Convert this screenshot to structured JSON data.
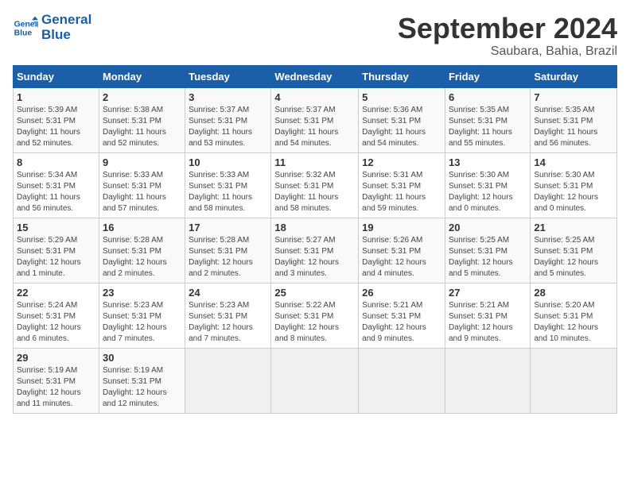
{
  "logo": {
    "line1": "General",
    "line2": "Blue"
  },
  "title": "September 2024",
  "subtitle": "Saubara, Bahia, Brazil",
  "days_of_week": [
    "Sunday",
    "Monday",
    "Tuesday",
    "Wednesday",
    "Thursday",
    "Friday",
    "Saturday"
  ],
  "weeks": [
    [
      {
        "day": "1",
        "info": "Sunrise: 5:39 AM\nSunset: 5:31 PM\nDaylight: 11 hours\nand 52 minutes."
      },
      {
        "day": "2",
        "info": "Sunrise: 5:38 AM\nSunset: 5:31 PM\nDaylight: 11 hours\nand 52 minutes."
      },
      {
        "day": "3",
        "info": "Sunrise: 5:37 AM\nSunset: 5:31 PM\nDaylight: 11 hours\nand 53 minutes."
      },
      {
        "day": "4",
        "info": "Sunrise: 5:37 AM\nSunset: 5:31 PM\nDaylight: 11 hours\nand 54 minutes."
      },
      {
        "day": "5",
        "info": "Sunrise: 5:36 AM\nSunset: 5:31 PM\nDaylight: 11 hours\nand 54 minutes."
      },
      {
        "day": "6",
        "info": "Sunrise: 5:35 AM\nSunset: 5:31 PM\nDaylight: 11 hours\nand 55 minutes."
      },
      {
        "day": "7",
        "info": "Sunrise: 5:35 AM\nSunset: 5:31 PM\nDaylight: 11 hours\nand 56 minutes."
      }
    ],
    [
      {
        "day": "8",
        "info": "Sunrise: 5:34 AM\nSunset: 5:31 PM\nDaylight: 11 hours\nand 56 minutes."
      },
      {
        "day": "9",
        "info": "Sunrise: 5:33 AM\nSunset: 5:31 PM\nDaylight: 11 hours\nand 57 minutes."
      },
      {
        "day": "10",
        "info": "Sunrise: 5:33 AM\nSunset: 5:31 PM\nDaylight: 11 hours\nand 58 minutes."
      },
      {
        "day": "11",
        "info": "Sunrise: 5:32 AM\nSunset: 5:31 PM\nDaylight: 11 hours\nand 58 minutes."
      },
      {
        "day": "12",
        "info": "Sunrise: 5:31 AM\nSunset: 5:31 PM\nDaylight: 11 hours\nand 59 minutes."
      },
      {
        "day": "13",
        "info": "Sunrise: 5:30 AM\nSunset: 5:31 PM\nDaylight: 12 hours\nand 0 minutes."
      },
      {
        "day": "14",
        "info": "Sunrise: 5:30 AM\nSunset: 5:31 PM\nDaylight: 12 hours\nand 0 minutes."
      }
    ],
    [
      {
        "day": "15",
        "info": "Sunrise: 5:29 AM\nSunset: 5:31 PM\nDaylight: 12 hours\nand 1 minute."
      },
      {
        "day": "16",
        "info": "Sunrise: 5:28 AM\nSunset: 5:31 PM\nDaylight: 12 hours\nand 2 minutes."
      },
      {
        "day": "17",
        "info": "Sunrise: 5:28 AM\nSunset: 5:31 PM\nDaylight: 12 hours\nand 2 minutes."
      },
      {
        "day": "18",
        "info": "Sunrise: 5:27 AM\nSunset: 5:31 PM\nDaylight: 12 hours\nand 3 minutes."
      },
      {
        "day": "19",
        "info": "Sunrise: 5:26 AM\nSunset: 5:31 PM\nDaylight: 12 hours\nand 4 minutes."
      },
      {
        "day": "20",
        "info": "Sunrise: 5:25 AM\nSunset: 5:31 PM\nDaylight: 12 hours\nand 5 minutes."
      },
      {
        "day": "21",
        "info": "Sunrise: 5:25 AM\nSunset: 5:31 PM\nDaylight: 12 hours\nand 5 minutes."
      }
    ],
    [
      {
        "day": "22",
        "info": "Sunrise: 5:24 AM\nSunset: 5:31 PM\nDaylight: 12 hours\nand 6 minutes."
      },
      {
        "day": "23",
        "info": "Sunrise: 5:23 AM\nSunset: 5:31 PM\nDaylight: 12 hours\nand 7 minutes."
      },
      {
        "day": "24",
        "info": "Sunrise: 5:23 AM\nSunset: 5:31 PM\nDaylight: 12 hours\nand 7 minutes."
      },
      {
        "day": "25",
        "info": "Sunrise: 5:22 AM\nSunset: 5:31 PM\nDaylight: 12 hours\nand 8 minutes."
      },
      {
        "day": "26",
        "info": "Sunrise: 5:21 AM\nSunset: 5:31 PM\nDaylight: 12 hours\nand 9 minutes."
      },
      {
        "day": "27",
        "info": "Sunrise: 5:21 AM\nSunset: 5:31 PM\nDaylight: 12 hours\nand 9 minutes."
      },
      {
        "day": "28",
        "info": "Sunrise: 5:20 AM\nSunset: 5:31 PM\nDaylight: 12 hours\nand 10 minutes."
      }
    ],
    [
      {
        "day": "29",
        "info": "Sunrise: 5:19 AM\nSunset: 5:31 PM\nDaylight: 12 hours\nand 11 minutes."
      },
      {
        "day": "30",
        "info": "Sunrise: 5:19 AM\nSunset: 5:31 PM\nDaylight: 12 hours\nand 12 minutes."
      },
      {
        "day": "",
        "info": ""
      },
      {
        "day": "",
        "info": ""
      },
      {
        "day": "",
        "info": ""
      },
      {
        "day": "",
        "info": ""
      },
      {
        "day": "",
        "info": ""
      }
    ]
  ]
}
